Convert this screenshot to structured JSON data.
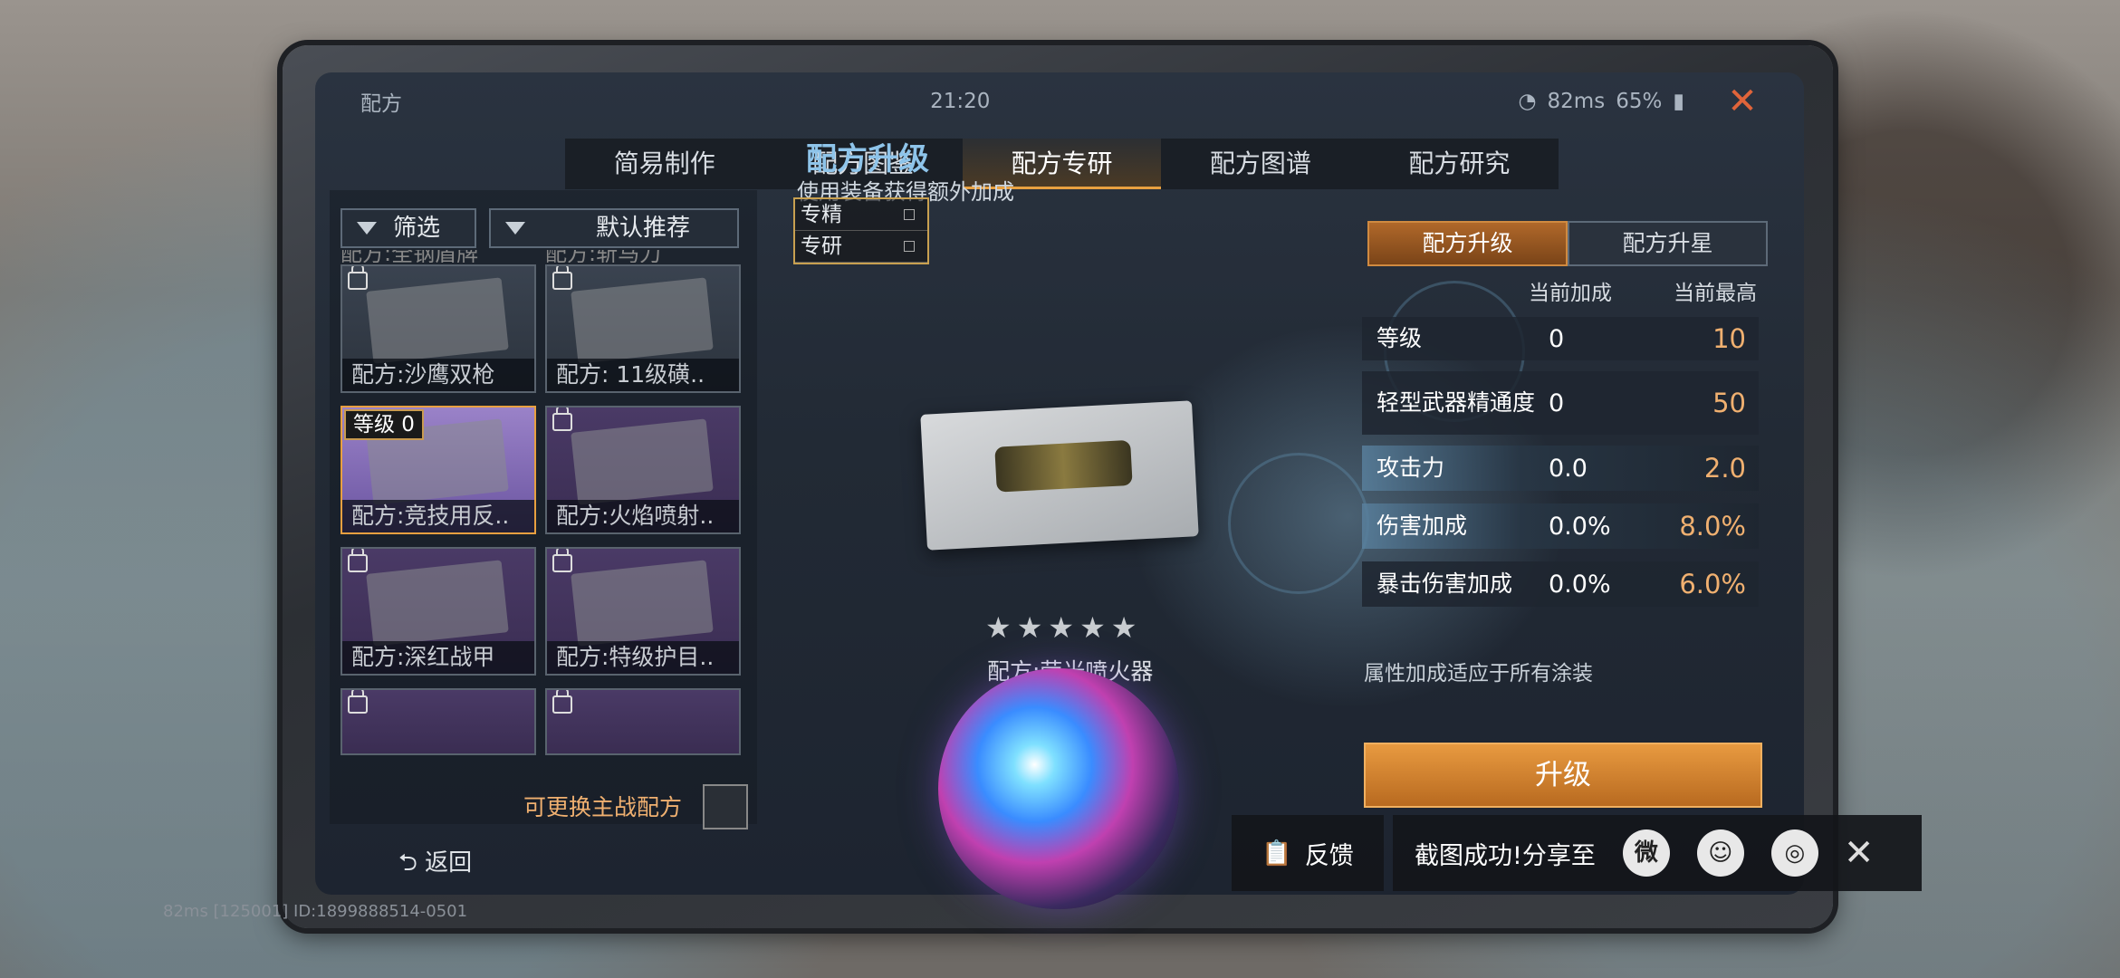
{
  "status_bar": {
    "title": "配方",
    "time": "21:20",
    "ping": "82ms",
    "battery": "65%"
  },
  "tabs": [
    {
      "label": "简易制作"
    },
    {
      "label": "配方图鉴"
    },
    {
      "label": "配方专研",
      "active": true
    },
    {
      "label": "配方图谱"
    },
    {
      "label": "配方研究"
    }
  ],
  "filters": {
    "filter_label": "筛选",
    "sort_label": "默认推荐"
  },
  "recipe_cards": [
    {
      "name": "配方:沙鹰双枪",
      "locked": true
    },
    {
      "name": "配方: 11级磺..",
      "locked": true
    },
    {
      "name": "配方:竞技用反..",
      "level": "等级 0",
      "selected": true
    },
    {
      "name": "配方:火焰喷射..",
      "locked": true
    },
    {
      "name": "配方:深红战甲",
      "locked": true
    },
    {
      "name": "配方:特级护目..",
      "locked": true
    }
  ],
  "cut_top_labels": [
    "配方:全钢盾牌",
    "配方:斩马刀"
  ],
  "center": {
    "title": "配方升级",
    "subtitle": "使用装备获得额外加成",
    "mini_tabs": [
      "专精",
      "专研"
    ],
    "stars": "★★★★★",
    "item_name": "配方:荧光喷火器"
  },
  "right_panel": {
    "tabs": [
      "配方升级",
      "配方升星"
    ],
    "head_current": "当前加成",
    "head_max": "当前最高",
    "rows": [
      {
        "label": "等级",
        "current": "0",
        "max": "10"
      },
      {
        "label": "轻型武器精通度",
        "current": "0",
        "max": "50"
      },
      {
        "label": "攻击力",
        "current": "0.0",
        "max": "2.0"
      },
      {
        "label": "伤害加成",
        "current": "0.0%",
        "max": "8.0%"
      },
      {
        "label": "暴击伤害加成",
        "current": "0.0%",
        "max": "6.0%"
      }
    ],
    "note": "属性加成适应于所有涂装",
    "upgrade_label": "升级"
  },
  "swap_label": "可更换主战配方",
  "back_label": "返回",
  "footer_text": "82ms  [125001] ID:1899888514-0501",
  "share": {
    "feedback_label": "反馈",
    "message": "截图成功!分享至"
  }
}
